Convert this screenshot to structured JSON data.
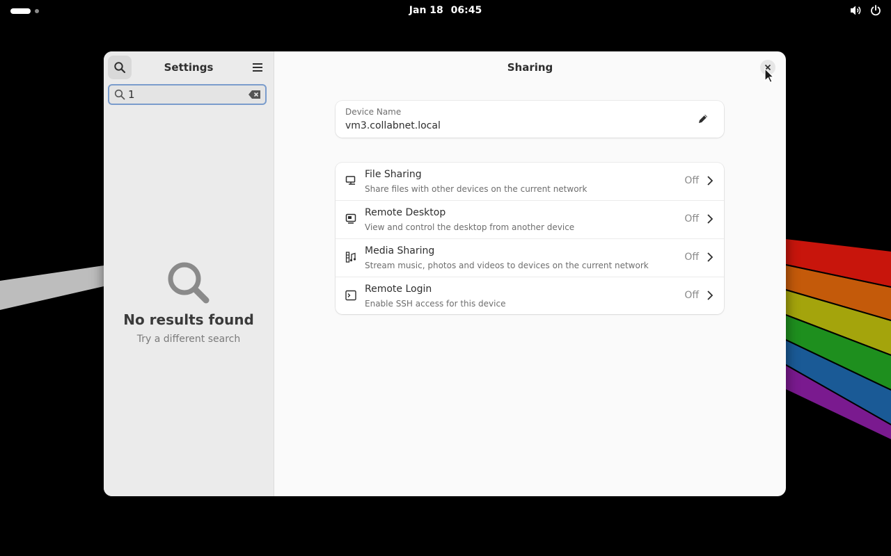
{
  "topbar": {
    "date": "Jan 18",
    "time": "06:45",
    "icons": [
      "activities-indicator",
      "volume-icon",
      "power-icon"
    ]
  },
  "sidebar": {
    "title": "Settings",
    "search_value": "1",
    "empty_state": {
      "title": "No results found",
      "subtitle": "Try a different search"
    }
  },
  "content": {
    "title": "Sharing",
    "device_name": {
      "label": "Device Name",
      "value": "vm3.collabnet.local"
    },
    "rows": [
      {
        "title": "File Sharing",
        "subtitle": "Share files with other devices on the current network",
        "status": "Off",
        "icon": "file-sharing-icon"
      },
      {
        "title": "Remote Desktop",
        "subtitle": "View and control the desktop from another device",
        "status": "Off",
        "icon": "remote-desktop-icon"
      },
      {
        "title": "Media Sharing",
        "subtitle": "Stream music, photos and videos to devices on the current network",
        "status": "Off",
        "icon": "media-sharing-icon"
      },
      {
        "title": "Remote Login",
        "subtitle": "Enable SSH access for this device",
        "status": "Off",
        "icon": "terminal-icon"
      }
    ]
  },
  "colors": {
    "desktop": "#000000",
    "window_bg": "#fafafa",
    "sidebar_bg": "#ebebeb",
    "focus_ring": "#7a9ccc"
  }
}
